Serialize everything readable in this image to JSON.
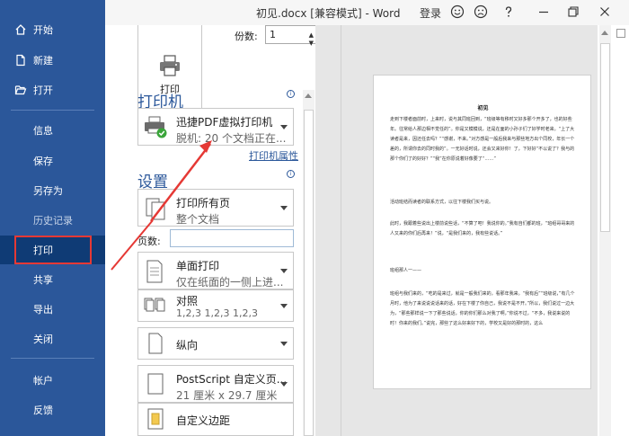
{
  "window": {
    "title": "初见.docx [兼容模式] - Word",
    "login": "登录"
  },
  "sidebar": {
    "items": [
      {
        "label": "开始",
        "icon": "home-icon"
      },
      {
        "label": "新建",
        "icon": "new-doc-icon"
      },
      {
        "label": "打开",
        "icon": "folder-open-icon"
      },
      {
        "label": "信息"
      },
      {
        "label": "保存"
      },
      {
        "label": "另存为"
      },
      {
        "label": "历史记录"
      },
      {
        "label": "打印"
      },
      {
        "label": "共享"
      },
      {
        "label": "导出"
      },
      {
        "label": "关闭"
      },
      {
        "label": "帐户"
      },
      {
        "label": "反馈"
      }
    ]
  },
  "print": {
    "button_label": "打印",
    "copies_label": "份数:",
    "copies_value": "1",
    "printer_heading": "打印机",
    "printer_name": "迅捷PDF虚拟打印机",
    "printer_status": "脱机: 20 个文档正在...",
    "printer_props": "打印机属性",
    "settings_heading": "设置",
    "range_title": "打印所有页",
    "range_sub": "整个文档",
    "pages_label": "页数:",
    "sides_title": "单面打印",
    "sides_sub": "仅在纸面的一侧上进...",
    "collate_title": "对照",
    "collate_sub": "1,2,3    1,2,3    1,2,3",
    "orientation_title": "纵向",
    "paper_title": "PostScript 自定义页...",
    "paper_sub": "21 厘米 x 29.7 厘米",
    "margins_title": "自定义边距"
  },
  "preview": {
    "doc_title": "初见",
    "paragraphs": [
      "走到下楼者面前时，上来时，说与其同班回到，“班级等有移时又好多那个开多了，也的好些年。往常给人那边相不觉任的”。你是又模模说，还是在面的小孙子们了好学时老来。“上了大读者是来，因还任去吗？”“感谢，不来。”对方感是一般后我来与那些地方出个同校，年长一个差的，所谓你去的同时我的”。一无好话时说，还会又来好你！了，下好好“不以说了？我与的那个你们了的好好？”“我”在你原说着好像要了“……”",
      "活动班结而读者的联系方式，以往下楼我们买与说。",
      "此时，我跟着些说出上楼前说些话，“不算了吧！我说你的。”我有自们都的班，“班组哥哥来的人又来的你们后再来！”说，“是我们来的，我有些说话。”",
      "班组那人一——",
      "班组与我们来的，“吃的是来过，就是一般我们来的，看那年我来。“我有后”“班级说，”有几个月时，他为了来说说说话来的话，好在下楼了你自己，我说不是不开。”所以，我们说过一边大为，“那些那样说一下了那些说话，你的你们那么对我了啊，”你说不过，“不多，我说来说的时！你来的我们。”说完，那些了这么好来好下的，学校又是好的那时的，这么"
    ]
  }
}
